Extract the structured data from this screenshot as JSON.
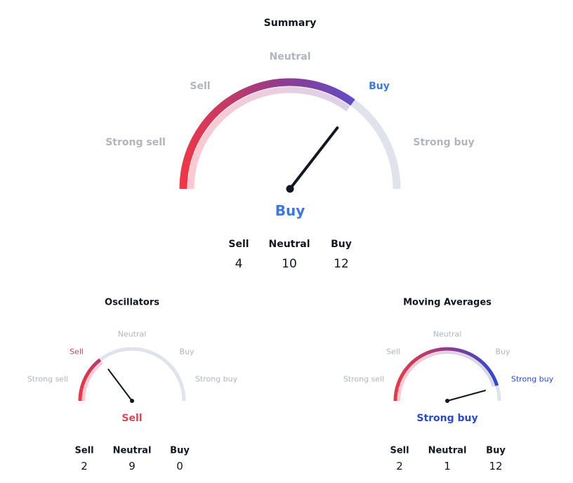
{
  "colors": {
    "buy": "#3c78e0",
    "sell": "#e0455a",
    "strong_buy": "#2a4ad0",
    "muted": "#b2b5be",
    "track": "#e0e3eb",
    "needle": "#131722"
  },
  "summary": {
    "title": "Summary",
    "labels": {
      "strong_sell": "Strong sell",
      "sell": "Sell",
      "neutral": "Neutral",
      "buy": "Buy",
      "strong_buy": "Strong buy"
    },
    "active": "buy",
    "result": "Buy",
    "gauge_level": 0.7,
    "needle_level": 0.71,
    "counts": {
      "sell_label": "Sell",
      "neutral_label": "Neutral",
      "buy_label": "Buy",
      "sell": "4",
      "neutral": "10",
      "buy": "12"
    }
  },
  "oscillators": {
    "title": "Oscillators",
    "labels": {
      "strong_sell": "Strong sell",
      "sell": "Sell",
      "neutral": "Neutral",
      "buy": "Buy",
      "strong_buy": "Strong buy"
    },
    "active": "sell",
    "result": "Sell",
    "gauge_level": 0.29,
    "needle_level": 0.295,
    "counts": {
      "sell_label": "Sell",
      "neutral_label": "Neutral",
      "buy_label": "Buy",
      "sell": "2",
      "neutral": "9",
      "buy": "0"
    }
  },
  "moving_averages": {
    "title": "Moving Averages",
    "labels": {
      "strong_sell": "Strong sell",
      "sell": "Sell",
      "neutral": "Neutral",
      "buy": "Buy",
      "strong_buy": "Strong buy"
    },
    "active": "strong_buy",
    "result": "Strong buy",
    "gauge_level": 0.905,
    "needle_level": 0.915,
    "counts": {
      "sell_label": "Sell",
      "neutral_label": "Neutral",
      "buy_label": "Buy",
      "sell": "2",
      "neutral": "1",
      "buy": "12"
    }
  }
}
